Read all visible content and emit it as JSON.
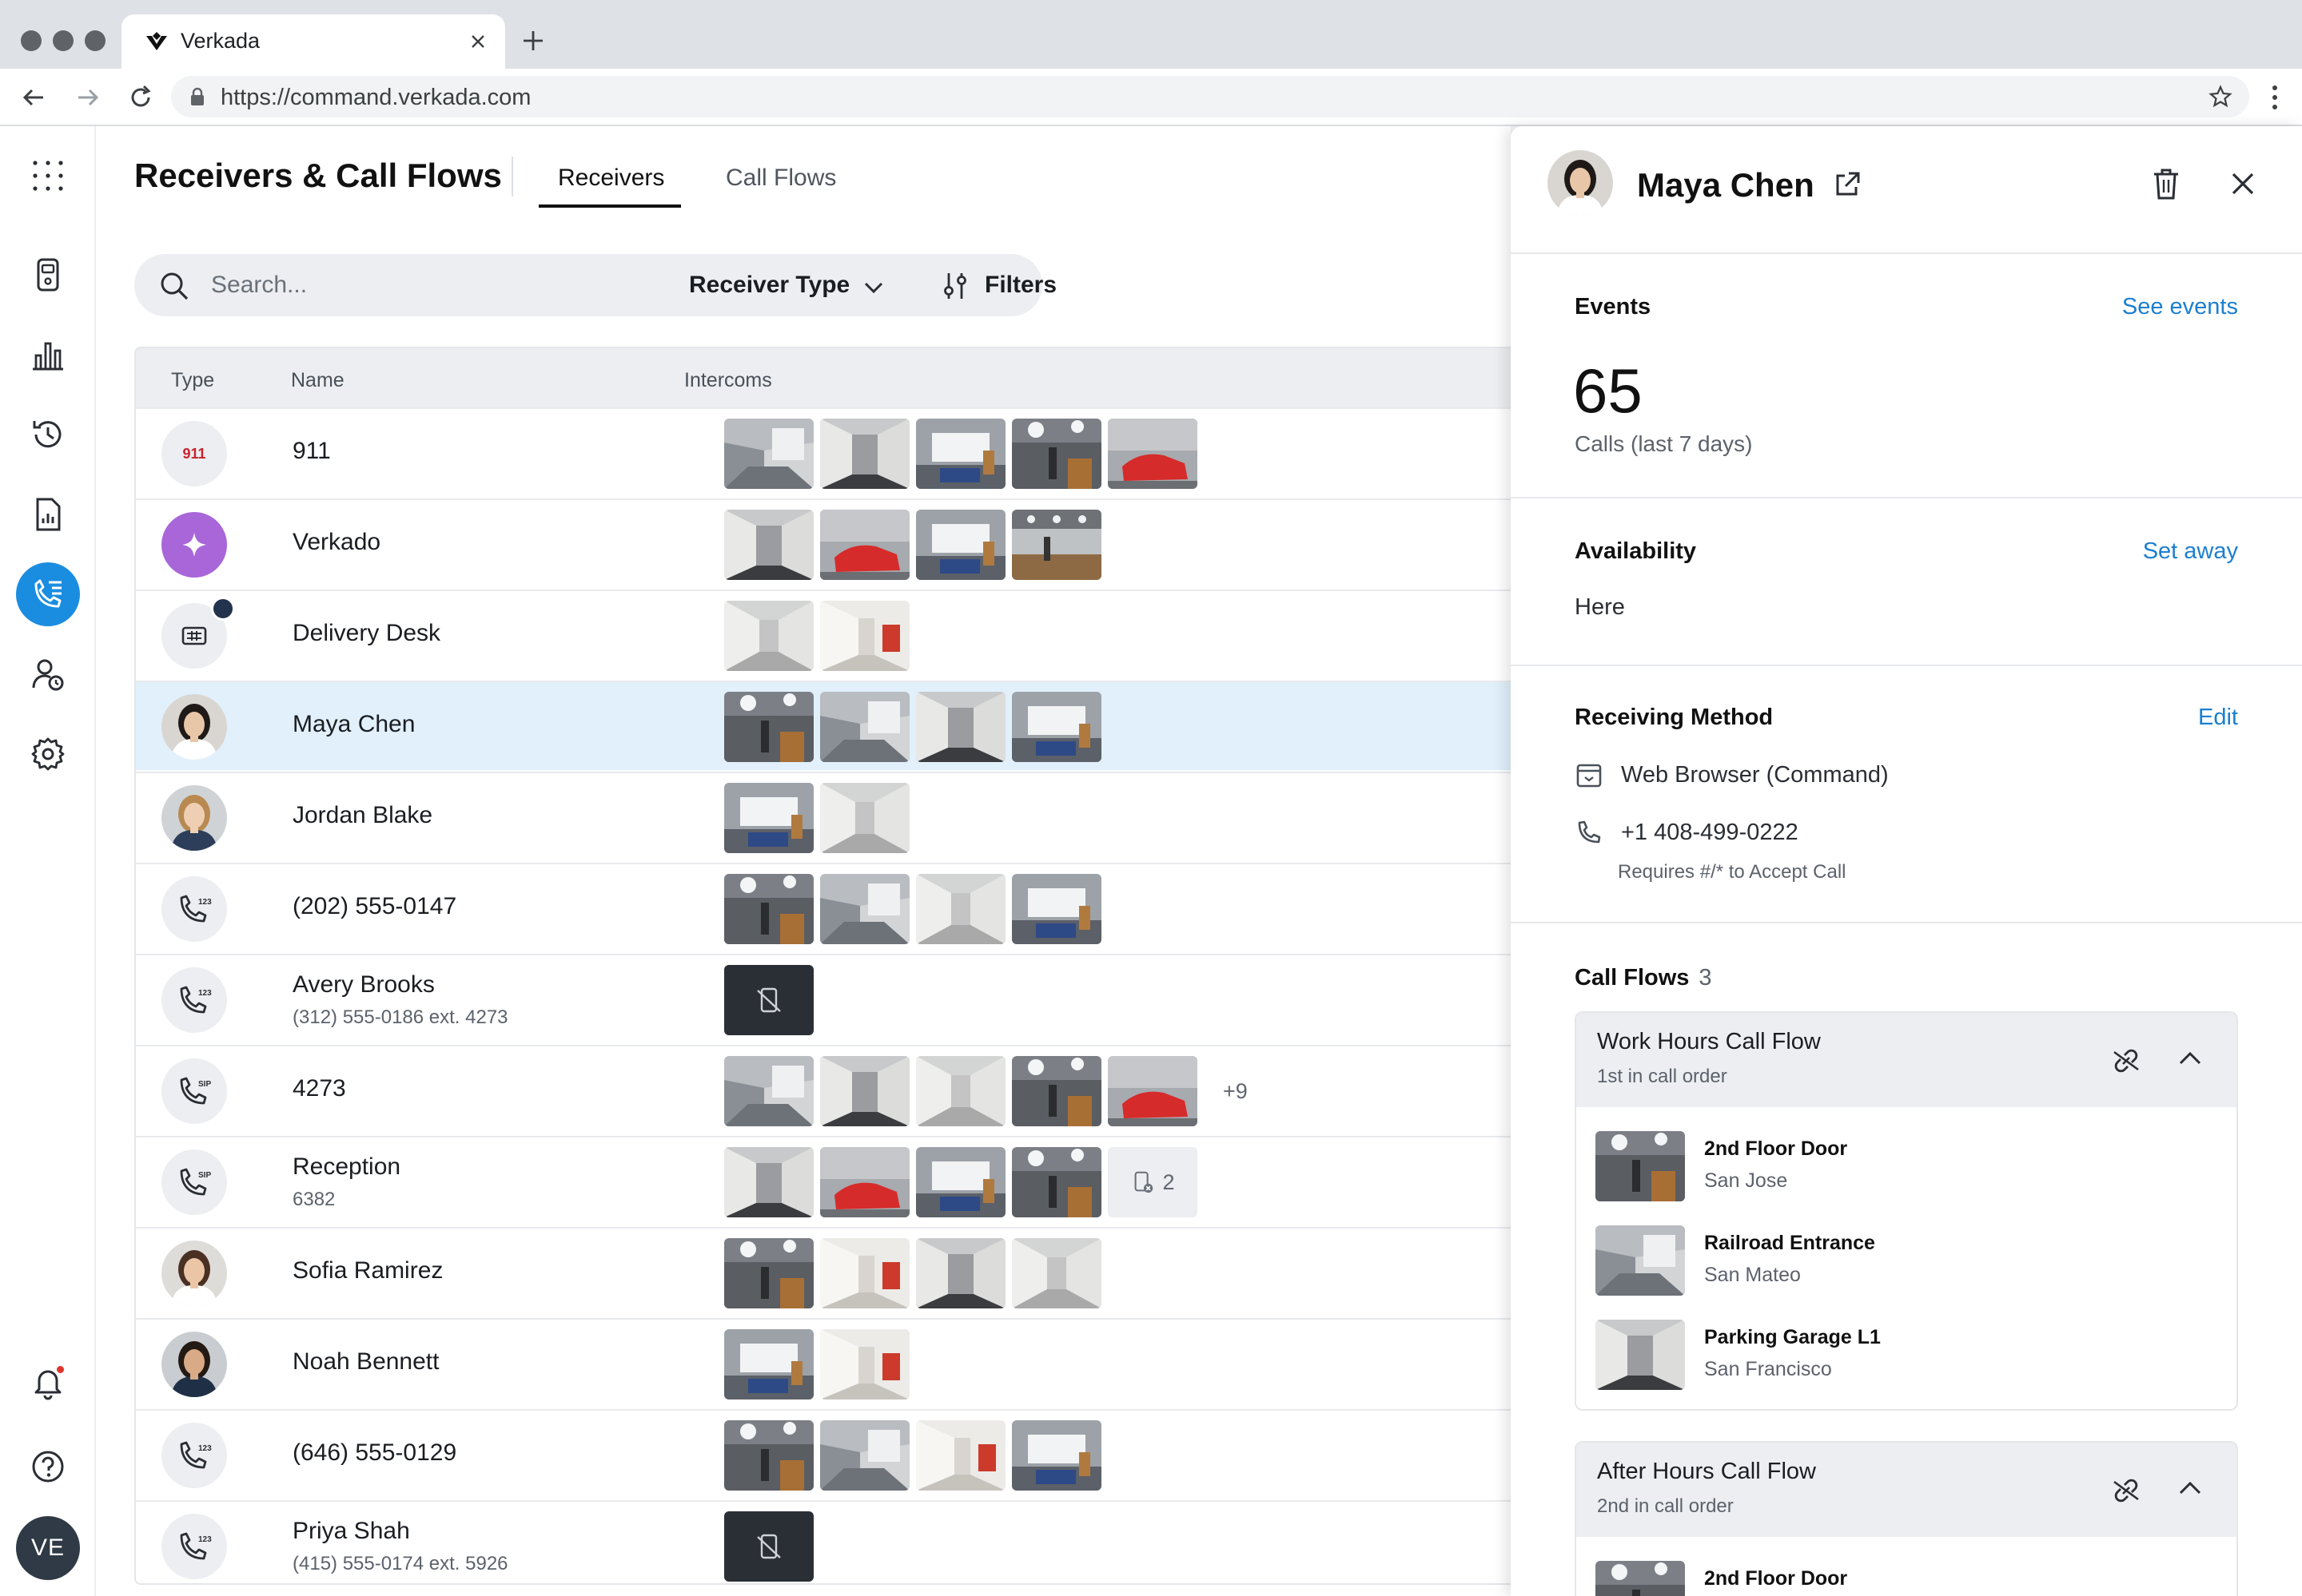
{
  "browser": {
    "tab_title": "Verkada",
    "url": "https://command.verkada.com"
  },
  "nav": {
    "items": [
      "apps-icon",
      "devices-icon",
      "analytics-icon",
      "history-icon",
      "reports-icon",
      "calls-icon",
      "user-access-icon",
      "settings-icon"
    ],
    "active": "calls-icon",
    "user_initials": "VE"
  },
  "page": {
    "title": "Receivers & Call Flows",
    "tabs": [
      "Receivers",
      "Call Flows"
    ],
    "active_tab": "Receivers"
  },
  "search": {
    "placeholder": "Search...",
    "receiver_type_label": "Receiver Type",
    "filters_label": "Filters"
  },
  "table": {
    "columns": [
      "Type",
      "Name",
      "Intercoms"
    ],
    "rows": [
      {
        "type": "911",
        "name": "911",
        "sub": "",
        "thumbs": [
          "a",
          "b",
          "c",
          "d",
          "e"
        ]
      },
      {
        "type": "ai",
        "name": "Verkado",
        "sub": "",
        "thumbs": [
          "b",
          "e",
          "c",
          "f"
        ]
      },
      {
        "type": "desk",
        "name": "Delivery Desk",
        "sub": "",
        "thumbs": [
          "g",
          "h"
        ]
      },
      {
        "type": "avatar-maya",
        "name": "Maya Chen",
        "sub": "",
        "thumbs": [
          "d",
          "a",
          "b",
          "c"
        ],
        "selected": true
      },
      {
        "type": "avatar-jordan",
        "name": "Jordan Blake",
        "sub": "",
        "thumbs": [
          "c",
          "g"
        ]
      },
      {
        "type": "phone123",
        "name": "(202) 555-0147",
        "sub": "",
        "thumbs": [
          "d",
          "a",
          "g",
          "c"
        ]
      },
      {
        "type": "phone123",
        "name": "Avery Brooks",
        "sub": "(312) 555-0186 ext. 4273",
        "thumbs": [
          "offline"
        ]
      },
      {
        "type": "phoneSIP",
        "name": "4273",
        "sub": "",
        "thumbs": [
          "a",
          "b",
          "g",
          "d",
          "e"
        ],
        "more": "+9"
      },
      {
        "type": "phoneSIP",
        "name": "Reception",
        "sub": "6382",
        "thumbs": [
          "b",
          "e",
          "c",
          "d"
        ],
        "chip": "2"
      },
      {
        "type": "avatar-sofia",
        "name": "Sofia Ramirez",
        "sub": "",
        "thumbs": [
          "d",
          "h",
          "b",
          "g"
        ]
      },
      {
        "type": "avatar-noah",
        "name": "Noah Bennett",
        "sub": "",
        "thumbs": [
          "c",
          "h"
        ]
      },
      {
        "type": "phone123",
        "name": "(646) 555-0129",
        "sub": "",
        "thumbs": [
          "d",
          "a",
          "h",
          "c"
        ]
      },
      {
        "type": "phone123",
        "name": "Priya Shah",
        "sub": "(415) 555-0174 ext. 5926",
        "thumbs": [
          "offline"
        ]
      }
    ]
  },
  "panel": {
    "name": "Maya Chen",
    "events": {
      "title": "Events",
      "link": "See events",
      "count": "65",
      "caption": "Calls (last 7 days)"
    },
    "availability": {
      "title": "Availability",
      "link": "Set away",
      "value": "Here"
    },
    "receiving_method": {
      "title": "Receiving Method",
      "link": "Edit",
      "browser": "Web Browser (Command)",
      "phone": "+1 408-499-0222",
      "phone_note": "Requires #/* to Accept Call"
    },
    "call_flows": {
      "title": "Call Flows",
      "count": "3",
      "flows": [
        {
          "name": "Work Hours Call Flow",
          "order": "1st in call order",
          "items": [
            {
              "name": "2nd Floor Door",
              "location": "San Jose"
            },
            {
              "name": "Railroad Entrance",
              "location": "San Mateo"
            },
            {
              "name": "Parking Garage L1",
              "location": "San Francisco"
            }
          ]
        },
        {
          "name": "After Hours Call Flow",
          "order": "2nd in call order",
          "items": [
            {
              "name": "2nd Floor Door",
              "location": ""
            }
          ]
        }
      ]
    }
  },
  "colors": {
    "accent": "#1b8de0",
    "link": "#1b7fd0",
    "selected_row": "#e1f0fb",
    "ai_badge": "#a866d9",
    "alert_red": "#c8242d"
  }
}
